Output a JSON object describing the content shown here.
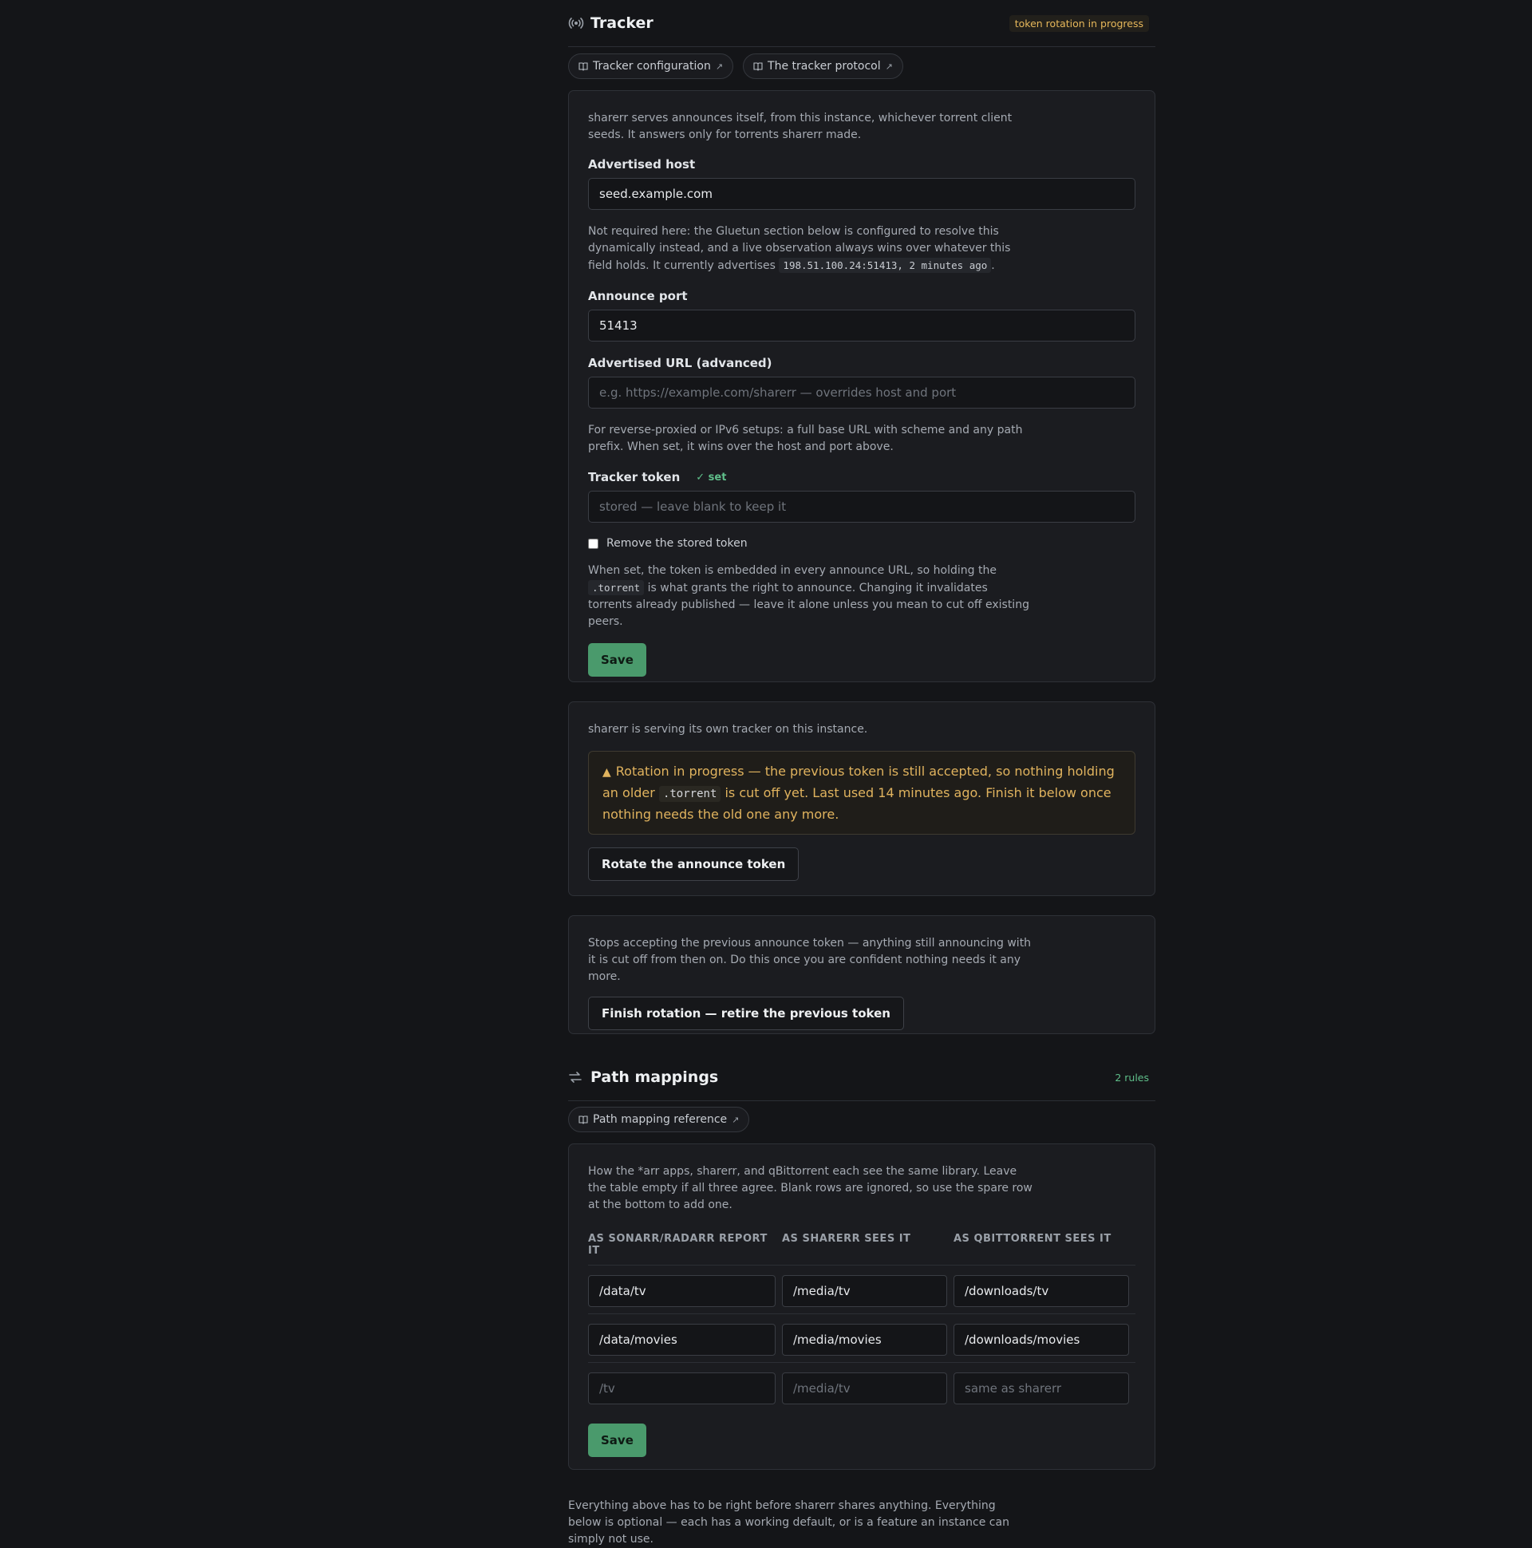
{
  "tracker": {
    "title": "Tracker",
    "badge": "token rotation in progress",
    "chips": [
      "Tracker configuration",
      "The tracker protocol"
    ],
    "intro": "sharerr serves announces itself, from this instance, whichever torrent client seeds. It answers only for torrents sharerr made.",
    "host_label": "Advertised host",
    "host_value": "seed.example.com",
    "host_help_pre": "Not required here: the Gluetun section below is configured to resolve this dynamically instead, and a live observation always wins over whatever this field holds. It currently advertises ",
    "host_help_code": "198.51.100.24:51413, 2 minutes ago",
    "host_help_post": ".",
    "port_label": "Announce port",
    "port_value": "51413",
    "url_label": "Advertised URL (advanced)",
    "url_placeholder": "e.g. https://example.com/sharerr — overrides host and port",
    "url_help": "For reverse-proxied or IPv6 setups: a full base URL with scheme and any path prefix. When set, it wins over the host and port above.",
    "token_label": "Tracker token",
    "token_badge": "✓ set",
    "token_placeholder": "stored — leave blank to keep it",
    "remove_label": "Remove the stored token",
    "token_help_pre": "When set, the token is embedded in every announce URL, so holding the ",
    "token_help_code": ".torrent",
    "token_help_post": " is what grants the right to announce. Changing it invalidates torrents already published — leave it alone unless you mean to cut off existing peers.",
    "save": "Save"
  },
  "rotation": {
    "status": "sharerr is serving its own tracker on this instance.",
    "warn_pre": "Rotation in progress — the previous token is still accepted, so nothing holding an older ",
    "warn_code": ".torrent",
    "warn_post": " is cut off yet. Last used 14 minutes ago. Finish it below once nothing needs the old one any more.",
    "rotate_button": "Rotate the announce token"
  },
  "finish": {
    "text": "Stops accepting the previous announce token — anything still announcing with it is cut off from then on. Do this once you are confident nothing needs it any more.",
    "button": "Finish rotation — retire the previous token"
  },
  "paths": {
    "title": "Path mappings",
    "badge": "2 rules",
    "chip": "Path mapping reference",
    "intro": "How the *arr apps, sharerr, and qBittorrent each see the same library. Leave the table empty if all three agree. Blank rows are ignored, so use the spare row at the bottom to add one.",
    "headers": [
      "AS SONARR/RADARR REPORT IT",
      "AS SHARERR SEES IT",
      "AS QBITTORRENT SEES IT"
    ],
    "rows": [
      [
        "/data/tv",
        "/media/tv",
        "/downloads/tv"
      ],
      [
        "/data/movies",
        "/media/movies",
        "/downloads/movies"
      ]
    ],
    "spare_placeholders": [
      "/tv",
      "/media/tv",
      "same as sharerr"
    ],
    "save": "Save"
  },
  "footer": "Everything above has to be right before sharerr shares anything. Everything below is optional — each has a working default, or is a feature an instance can simply not use."
}
